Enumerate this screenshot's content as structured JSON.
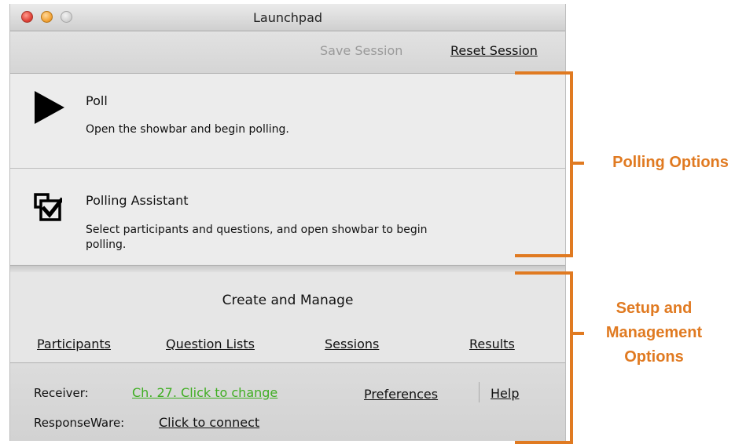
{
  "window": {
    "title": "Launchpad"
  },
  "toolbar": {
    "save_label": "Save Session",
    "reset_label": "Reset Session"
  },
  "poll": {
    "icon": "play-icon",
    "title": "Poll",
    "description": "Open the showbar and begin polling."
  },
  "assistant": {
    "icon": "polling-assistant-icon",
    "title": "Polling Assistant",
    "description_line1": "Select participants and questions, and open showbar to begin",
    "description_line2": "polling."
  },
  "manage": {
    "heading": "Create and Manage",
    "links": {
      "participants": "Participants",
      "question_lists": "Question Lists",
      "sessions": "Sessions",
      "results": "Results"
    }
  },
  "footer": {
    "receiver_label": "Receiver:",
    "receiver_value": "Ch. 27. Click to change",
    "preferences": "Preferences",
    "help": "Help",
    "responseware_label": "ResponseWare:",
    "responseware_link": "Click to connect"
  },
  "annotations": {
    "polling": "Polling Options",
    "setup_line1": "Setup and",
    "setup_line2": "Management",
    "setup_line3": "Options",
    "color": "#e07a21"
  }
}
